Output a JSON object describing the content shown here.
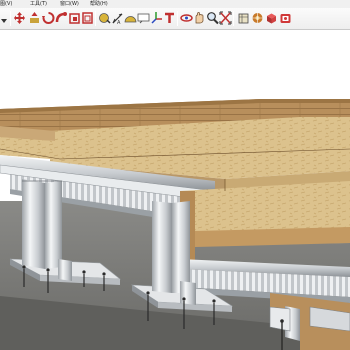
{
  "menu": {
    "items": [
      {
        "id": "view-partial",
        "label": "图(V)"
      },
      {
        "id": "tools",
        "label": "工具(T)"
      },
      {
        "id": "window",
        "label": "窗口(W)"
      },
      {
        "id": "help",
        "label": "帮助(H)"
      }
    ]
  },
  "toolbar": {
    "tools": [
      {
        "name": "move-icon",
        "title": "Move"
      },
      {
        "name": "push-pull-icon",
        "title": "Push/Pull"
      },
      {
        "name": "rotate-icon",
        "title": "Rotate"
      },
      {
        "name": "follow-me-icon",
        "title": "Follow Me"
      },
      {
        "name": "scale-icon",
        "title": "Scale"
      },
      {
        "name": "offset-icon",
        "title": "Offset"
      },
      {
        "name": "tape-measure-icon",
        "title": "Tape Measure"
      },
      {
        "name": "dimension-icon",
        "title": "Dimension"
      },
      {
        "name": "protractor-icon",
        "title": "Protractor"
      },
      {
        "name": "text-icon",
        "title": "Text"
      },
      {
        "name": "axes-icon",
        "title": "Axes"
      },
      {
        "name": "3d-text-icon",
        "title": "3D Text"
      },
      {
        "name": "orbit-icon",
        "title": "Orbit"
      },
      {
        "name": "pan-icon",
        "title": "Pan"
      },
      {
        "name": "zoom-icon",
        "title": "Zoom"
      },
      {
        "name": "zoom-extents-icon",
        "title": "Zoom Extents"
      },
      {
        "name": "3d-warehouse-icon",
        "title": "3D Warehouse"
      },
      {
        "name": "share-model-icon",
        "title": "Share Model"
      },
      {
        "name": "component-icon",
        "title": "Components"
      },
      {
        "name": "extension-icon",
        "title": "Extensions"
      }
    ]
  },
  "colors": {
    "toolbar_bg": "#eeeeee",
    "wood_top": "#c7a775",
    "wood_plank": "#b58a55",
    "osb": "#d9c08a",
    "steel": "#d6d9dc",
    "ground": "#7d7d7a"
  }
}
